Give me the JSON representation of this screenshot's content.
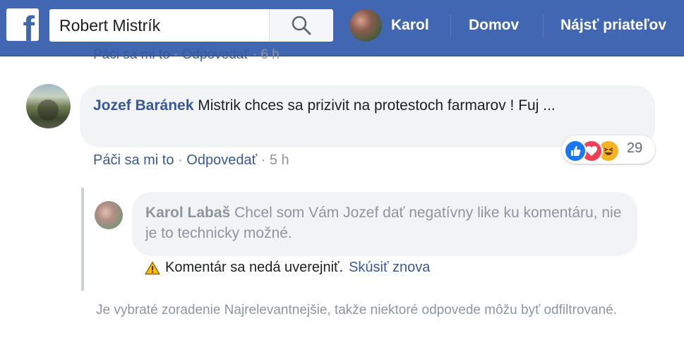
{
  "header": {
    "logo": "f",
    "search": {
      "value": "Robert Mistrík",
      "icon": "search-icon"
    },
    "user_name": "Karol",
    "nav": {
      "home": "Domov",
      "find_friends": "Nájsť priateľov"
    }
  },
  "previous_actions": {
    "like": "Páči sa mi to",
    "separator": "·",
    "reply": "Odpovedať",
    "time": "6 h"
  },
  "comment": {
    "author": "Jozef Baránek",
    "text": "Mistrik chces sa prizivit na protestoch farmarov ! Fuj ...",
    "reactions": {
      "types": [
        "like",
        "love",
        "haha"
      ],
      "count": "29"
    },
    "actions": {
      "like": "Páči sa mi to",
      "separator": "·",
      "reply": "Odpovedať",
      "time": "5 h"
    }
  },
  "reply": {
    "author": "Karol Labaš",
    "text": "Chcel som Vám Jozef dať negatívny like ku komentáru, nie je to technicky možné.",
    "error": {
      "message": "Komentár sa nedá uverejniť.",
      "retry": "Skúsiť znova"
    }
  },
  "filter_note": "Je vybraté zoradenie Najrelevantnejšie, takže niektoré odpovede môžu byť odfiltrované.",
  "colors": {
    "brand_blue": "#4267b2",
    "link_blue": "#385898",
    "bubble_gray": "#f2f3f5",
    "muted_gray": "#90949c"
  }
}
